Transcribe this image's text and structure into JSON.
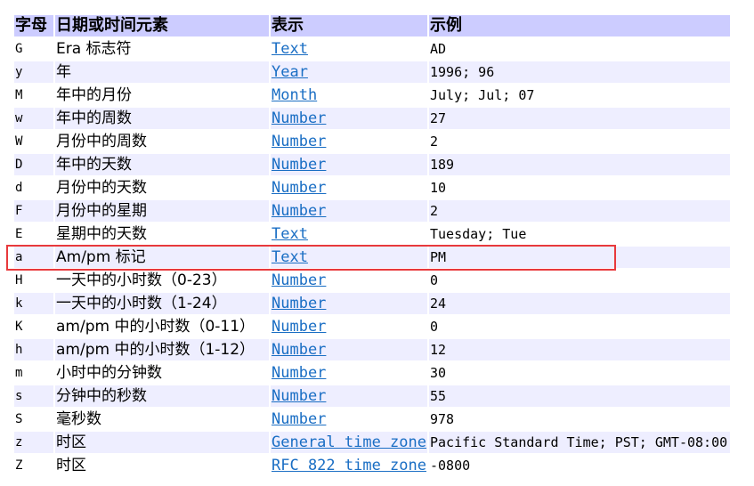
{
  "headers": [
    "字母",
    "日期或时间元素",
    "表示",
    "示例"
  ],
  "rows": [
    {
      "letter": "G",
      "element": "Era 标志符",
      "presentation": "Text",
      "example": "AD"
    },
    {
      "letter": "y",
      "element": "年",
      "presentation": "Year",
      "example": "1996; 96"
    },
    {
      "letter": "M",
      "element": "年中的月份",
      "presentation": "Month",
      "example": "July; Jul; 07"
    },
    {
      "letter": "w",
      "element": "年中的周数",
      "presentation": "Number",
      "example": "27"
    },
    {
      "letter": "W",
      "element": "月份中的周数",
      "presentation": "Number",
      "example": "2"
    },
    {
      "letter": "D",
      "element": "年中的天数",
      "presentation": "Number",
      "example": "189"
    },
    {
      "letter": "d",
      "element": "月份中的天数",
      "presentation": "Number",
      "example": "10"
    },
    {
      "letter": "F",
      "element": "月份中的星期",
      "presentation": "Number",
      "example": "2"
    },
    {
      "letter": "E",
      "element": "星期中的天数",
      "presentation": "Text",
      "example": "Tuesday; Tue"
    },
    {
      "letter": "a",
      "element": "Am/pm 标记",
      "presentation": "Text",
      "example": "PM"
    },
    {
      "letter": "H",
      "element": "一天中的小时数（0-23）",
      "presentation": "Number",
      "example": "0"
    },
    {
      "letter": "k",
      "element": "一天中的小时数（1-24）",
      "presentation": "Number",
      "example": "24"
    },
    {
      "letter": "K",
      "element": "am/pm 中的小时数（0-11）",
      "presentation": "Number",
      "example": "0"
    },
    {
      "letter": "h",
      "element": "am/pm 中的小时数（1-12）",
      "presentation": "Number",
      "example": "12"
    },
    {
      "letter": "m",
      "element": "小时中的分钟数",
      "presentation": "Number",
      "example": "30"
    },
    {
      "letter": "s",
      "element": "分钟中的秒数",
      "presentation": "Number",
      "example": "55"
    },
    {
      "letter": "S",
      "element": "毫秒数",
      "presentation": "Number",
      "example": "978"
    },
    {
      "letter": "z",
      "element": "时区",
      "presentation": "General time zone",
      "example": "Pacific Standard Time; PST; GMT-08:00"
    },
    {
      "letter": "Z",
      "element": "时区",
      "presentation": "RFC 822 time zone",
      "example": "-0800"
    }
  ],
  "highlighted_row_index": 9,
  "colors": {
    "header_bg": "#ccccff",
    "alt_row_bg": "#eeeeff",
    "link": "#1a6ec4",
    "highlight_border": "#e8393c"
  }
}
